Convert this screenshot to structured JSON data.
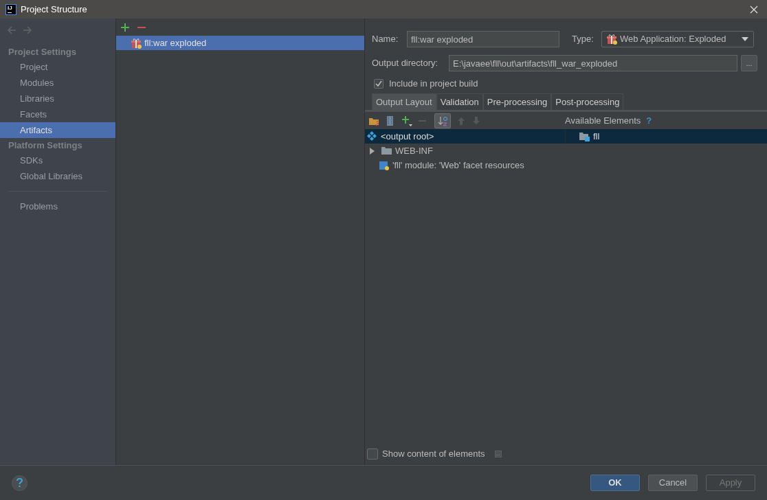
{
  "window": {
    "title": "Project Structure",
    "logo_text": "IJ"
  },
  "sidebar": {
    "sections": [
      {
        "title": "Project Settings",
        "items": [
          {
            "label": "Project",
            "selected": false
          },
          {
            "label": "Modules",
            "selected": false
          },
          {
            "label": "Libraries",
            "selected": false
          },
          {
            "label": "Facets",
            "selected": false
          },
          {
            "label": "Artifacts",
            "selected": true
          }
        ]
      },
      {
        "title": "Platform Settings",
        "items": [
          {
            "label": "SDKs",
            "selected": false
          },
          {
            "label": "Global Libraries",
            "selected": false
          }
        ]
      }
    ],
    "footer_items": [
      {
        "label": "Problems",
        "selected": false
      }
    ]
  },
  "artifacts": [
    {
      "label": "fll:war exploded",
      "selected": true
    }
  ],
  "form": {
    "name_label": "Name:",
    "name_value": "fll:war exploded",
    "type_label": "Type:",
    "type_value": "Web Application: Exploded",
    "output_label": "Output directory:",
    "output_value": "E:\\javaee\\fll\\out\\artifacts\\fll_war_exploded",
    "browse": "...",
    "include_label": "Include in project build",
    "include_checked": true
  },
  "tabs": [
    {
      "label": "Output Layout",
      "selected": true
    },
    {
      "label": "Validation",
      "selected": false
    },
    {
      "label": "Pre-processing",
      "selected": false
    },
    {
      "label": "Post-processing",
      "selected": false
    }
  ],
  "available_header": "Available Elements",
  "help_mark": "?",
  "layout_tree": [
    {
      "kind": "root",
      "label": "<output root>",
      "selected": true
    },
    {
      "kind": "folder",
      "label": "WEB-INF",
      "expanded": false,
      "selected": false
    },
    {
      "kind": "resource",
      "label": "'fll' module: 'Web' facet resources",
      "selected": false
    }
  ],
  "available_tree": [
    {
      "kind": "module",
      "label": "fll",
      "selected": true
    }
  ],
  "show_content": {
    "label": "Show content of elements",
    "checked": false,
    "more": "..."
  },
  "buttons": [
    {
      "label": "OK",
      "kind": "primary"
    },
    {
      "label": "Cancel",
      "kind": "normal"
    },
    {
      "label": "Apply",
      "kind": "disabled"
    }
  ]
}
